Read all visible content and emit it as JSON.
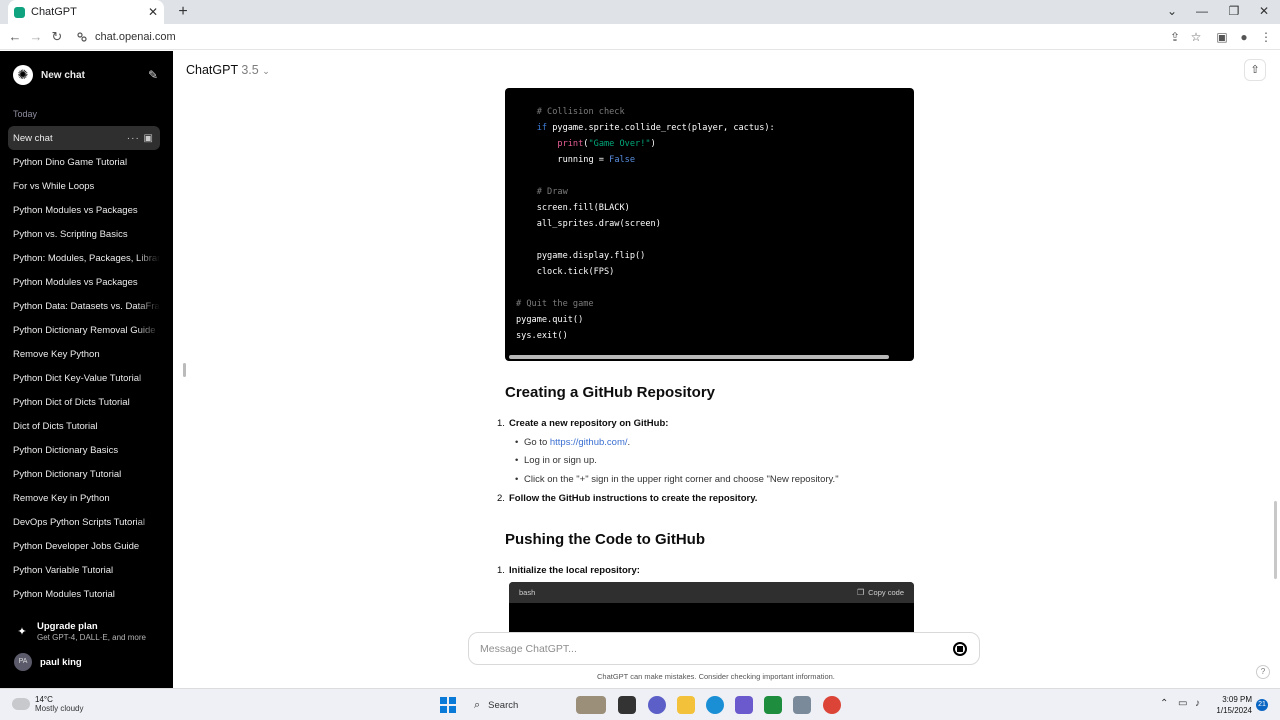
{
  "browser": {
    "tab_title": "ChatGPT",
    "tab_close": "✕",
    "new_tab": "+",
    "url": "chat.openai.com"
  },
  "sidebar": {
    "new_chat": "New chat",
    "section_today": "Today",
    "items": [
      {
        "label": "New chat",
        "active": true
      },
      {
        "label": "Python Dino Game Tutorial"
      },
      {
        "label": "For vs While Loops"
      },
      {
        "label": "Python Modules vs Packages"
      },
      {
        "label": "Python vs. Scripting Basics"
      },
      {
        "label": "Python: Modules, Packages, Libraries"
      },
      {
        "label": "Python Modules vs Packages"
      },
      {
        "label": "Python Data: Datasets vs. DataFrames"
      },
      {
        "label": "Python Dictionary Removal Guide"
      },
      {
        "label": "Remove Key Python"
      },
      {
        "label": "Python Dict Key-Value Tutorial"
      },
      {
        "label": "Python Dict of Dicts Tutorial"
      },
      {
        "label": "Dict of Dicts Tutorial"
      },
      {
        "label": "Python Dictionary Basics"
      },
      {
        "label": "Python Dictionary Tutorial"
      },
      {
        "label": "Remove Key in Python"
      },
      {
        "label": "DevOps Python Scripts Tutorial"
      },
      {
        "label": "Python Developer Jobs Guide"
      },
      {
        "label": "Python Variable Tutorial"
      },
      {
        "label": "Python Modules Tutorial"
      }
    ],
    "upgrade_title": "Upgrade plan",
    "upgrade_sub": "Get GPT-4, DALL·E, and more",
    "user_initials": "PA",
    "user_name": "paul king"
  },
  "header": {
    "model": "ChatGPT",
    "version": "3.5"
  },
  "code": {
    "lines": [
      {
        "indent": "    ",
        "parts": [
          {
            "t": "# Collision check",
            "c": "c-comment"
          }
        ]
      },
      {
        "indent": "    ",
        "parts": [
          {
            "t": "if",
            "c": "c-key"
          },
          {
            "t": " pygame.sprite.collide_rect(player, cactus):",
            "c": ""
          }
        ]
      },
      {
        "indent": "        ",
        "parts": [
          {
            "t": "print",
            "c": "c-fn"
          },
          {
            "t": "(",
            "c": ""
          },
          {
            "t": "\"Game Over!\"",
            "c": "c-str"
          },
          {
            "t": ")",
            "c": ""
          }
        ]
      },
      {
        "indent": "        ",
        "parts": [
          {
            "t": "running = ",
            "c": ""
          },
          {
            "t": "False",
            "c": "c-const"
          }
        ]
      },
      {
        "indent": "",
        "parts": []
      },
      {
        "indent": "    ",
        "parts": [
          {
            "t": "# Draw",
            "c": "c-comment"
          }
        ]
      },
      {
        "indent": "    ",
        "parts": [
          {
            "t": "screen.fill(BLACK)",
            "c": ""
          }
        ]
      },
      {
        "indent": "    ",
        "parts": [
          {
            "t": "all_sprites.draw(screen)",
            "c": ""
          }
        ]
      },
      {
        "indent": "",
        "parts": []
      },
      {
        "indent": "    ",
        "parts": [
          {
            "t": "pygame.display.flip()",
            "c": ""
          }
        ]
      },
      {
        "indent": "    ",
        "parts": [
          {
            "t": "clock.tick(FPS)",
            "c": ""
          }
        ]
      },
      {
        "indent": "",
        "parts": []
      },
      {
        "indent": "",
        "parts": [
          {
            "t": "# Quit the game",
            "c": "c-comment"
          }
        ]
      },
      {
        "indent": "",
        "parts": [
          {
            "t": "pygame.quit()",
            "c": ""
          }
        ]
      },
      {
        "indent": "",
        "parts": [
          {
            "t": "sys.exit()",
            "c": ""
          }
        ]
      }
    ]
  },
  "content": {
    "h_github": "Creating a GitHub Repository",
    "step1_num": "1.",
    "step1": "Create a new repository on GitHub:",
    "bullet1_pre": "Go to ",
    "bullet1_link": "https://github.com/",
    "bullet1_post": ".",
    "bullet2": "Log in or sign up.",
    "bullet3": "Click on the \"+\" sign in the upper right corner and choose \"New repository.\"",
    "step2_num": "2.",
    "step2": "Follow the GitHub instructions to create the repository.",
    "h_push": "Pushing the Code to GitHub",
    "push1_num": "1.",
    "push1": "Initialize the local repository:",
    "bash_lang": "bash",
    "copy_code": "Copy code"
  },
  "composer": {
    "placeholder": "Message ChatGPT...",
    "disclaimer": "ChatGPT can make mistakes. Consider checking important information."
  },
  "taskbar": {
    "temp": "14°C",
    "condition": "Mostly cloudy",
    "search": "Search",
    "time": "3:09 PM",
    "date": "1/15/2024",
    "notifications": "21"
  },
  "colors": {
    "sidebar_bg": "#000000",
    "accent": "#10a37f",
    "link": "#3b6fd1"
  }
}
